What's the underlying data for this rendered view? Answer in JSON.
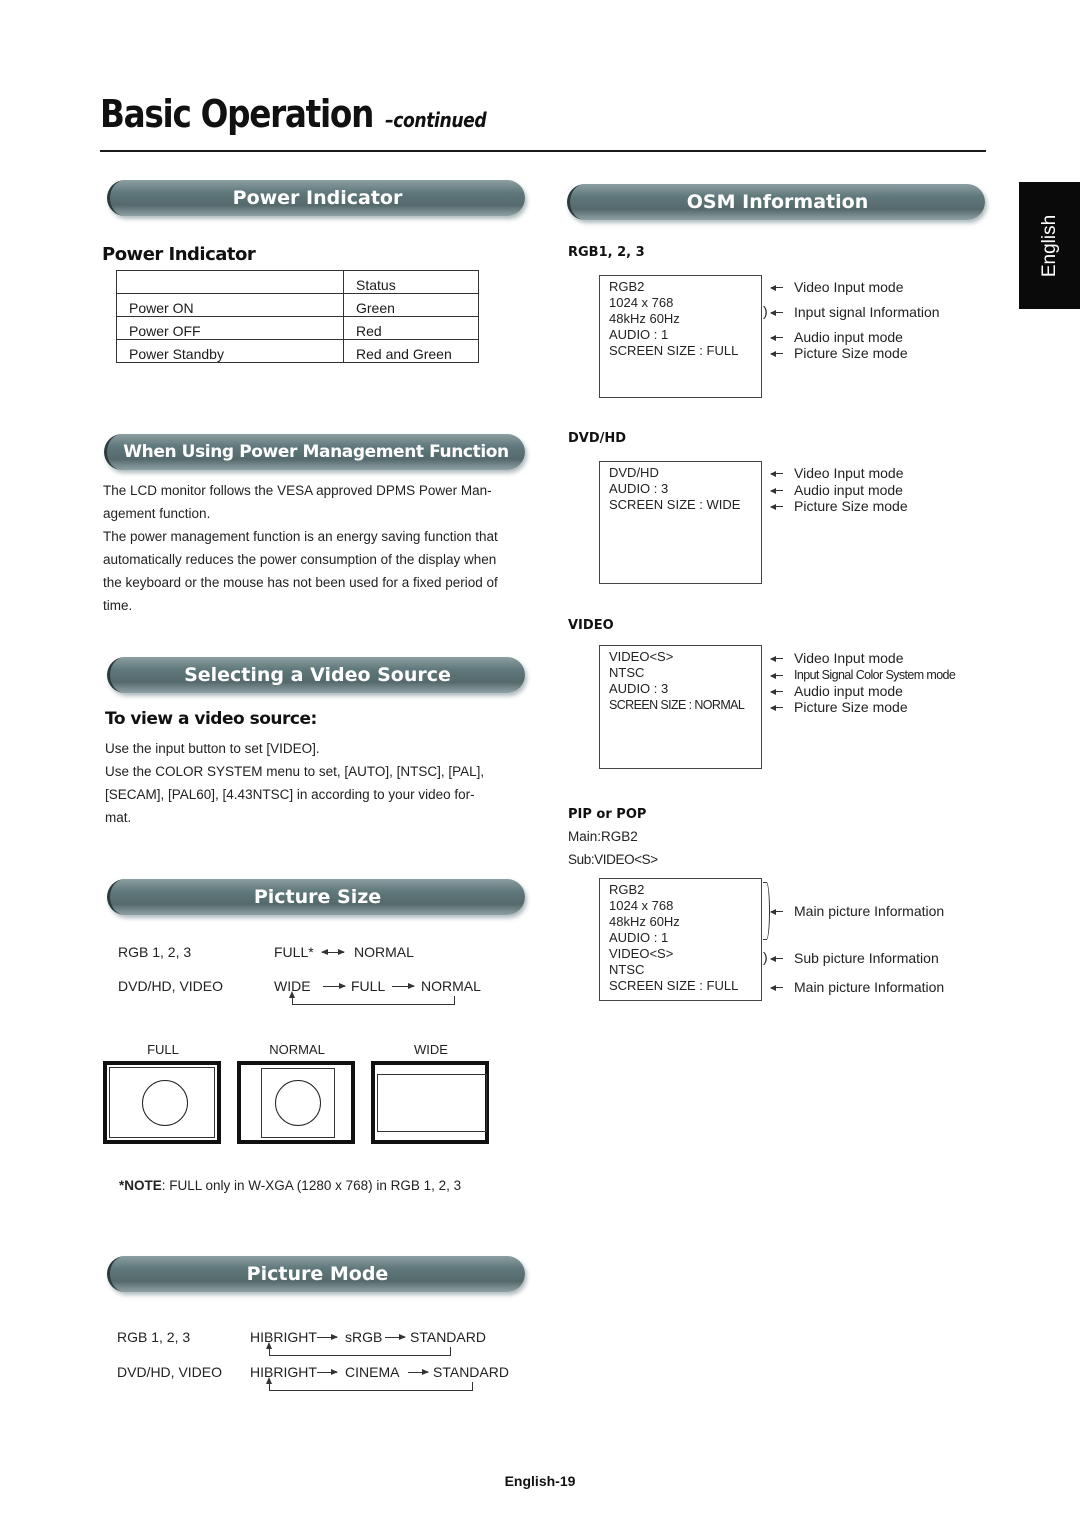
{
  "header": {
    "title": "Basic Operation",
    "title_suffix": "–continued"
  },
  "language_tab": "English",
  "power_indicator": {
    "banner": "Power Indicator",
    "subhead": "Power Indicator",
    "table": {
      "header": [
        "",
        "Status"
      ],
      "rows": [
        [
          "Power ON",
          "Green"
        ],
        [
          "Power OFF",
          "Red"
        ],
        [
          "Power Standby",
          "Red and Green"
        ]
      ]
    }
  },
  "power_management": {
    "banner": "When Using Power Management Function",
    "lines": [
      "The LCD monitor follows the VESA approved DPMS Power Man-",
      "agement function.",
      "The power management function is an energy saving function that",
      "automatically reduces the power consumption of the display when",
      "the keyboard or the mouse has not been used for a fixed period of",
      "time."
    ]
  },
  "video_source": {
    "banner": "Selecting a Video Source",
    "subhead": "To view a video source:",
    "lines": [
      "Use the input button to set [VIDEO].",
      "Use the COLOR SYSTEM menu to set, [AUTO], [NTSC], [PAL],",
      "[SECAM], [PAL60], [4.43NTSC] in according to your video for-",
      "mat."
    ]
  },
  "picture_size": {
    "banner": "Picture Size",
    "rows": [
      {
        "source": "RGB 1, 2, 3",
        "modes": [
          "FULL*",
          "NORMAL"
        ],
        "cycle": "bidirectional"
      },
      {
        "source": "DVD/HD, VIDEO",
        "modes": [
          "WIDE",
          "FULL",
          "NORMAL"
        ],
        "cycle": "loop"
      }
    ],
    "diagrams": [
      {
        "label": "FULL"
      },
      {
        "label": "NORMAL"
      },
      {
        "label": "WIDE"
      }
    ],
    "note_label": "*NOTE",
    "note_text": ": FULL only in W-XGA (1280 x 768) in RGB 1, 2, 3"
  },
  "picture_mode": {
    "banner": "Picture Mode",
    "rows": [
      {
        "source": "RGB 1, 2, 3",
        "modes": [
          "HIBRIGHT",
          "sRGB",
          "STANDARD"
        ]
      },
      {
        "source": "DVD/HD, VIDEO",
        "modes": [
          "HIBRIGHT",
          "CINEMA",
          "STANDARD"
        ]
      }
    ]
  },
  "osm": {
    "banner": "OSM Information",
    "sections": [
      {
        "heading": "RGB1, 2, 3",
        "lines": [
          "RGB2",
          "1024 x 768",
          "48kHz  60Hz",
          "AUDIO : 1",
          "SCREEN SIZE : FULL"
        ],
        "callouts": [
          "Video Input mode",
          "Input signal Information",
          "Audio input mode",
          "Picture Size mode"
        ]
      },
      {
        "heading": "DVD/HD",
        "lines": [
          "DVD/HD",
          "AUDIO : 3",
          "SCREEN SIZE : WIDE"
        ],
        "callouts": [
          "Video Input mode",
          "Audio input mode",
          "Picture Size mode"
        ]
      },
      {
        "heading": "VIDEO",
        "lines": [
          "VIDEO<S>",
          "NTSC",
          "AUDIO : 3",
          "SCREEN SIZE : NORMAL"
        ],
        "callouts": [
          "Video Input mode",
          "Input Signal Color System mode",
          "Audio input mode",
          "Picture Size mode"
        ]
      },
      {
        "heading": "PIP or POP",
        "main": "Main:RGB2",
        "sub": "Sub:VIDEO<S>",
        "lines": [
          "RGB2",
          "1024 x 768",
          "48kHz  60Hz",
          "AUDIO : 1",
          "VIDEO<S>",
          "NTSC",
          "SCREEN SIZE : FULL"
        ],
        "callouts": [
          "Main picture Information",
          "Sub picture Information",
          "Main picture Information"
        ]
      }
    ]
  },
  "footer": "English-19"
}
